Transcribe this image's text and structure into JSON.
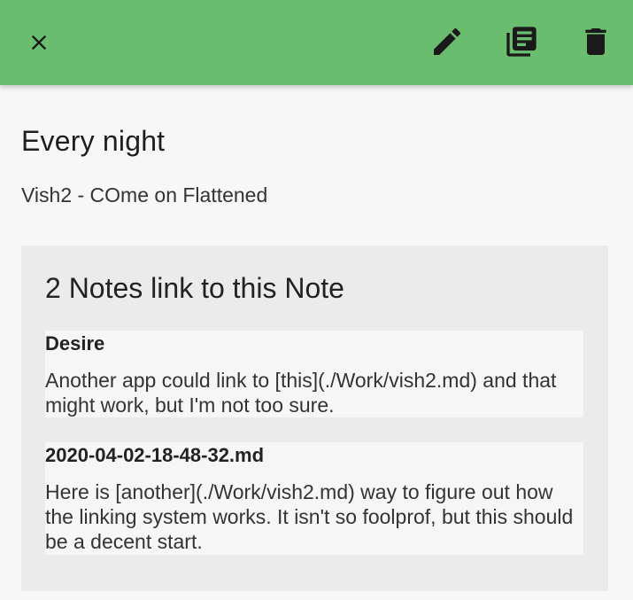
{
  "appbar": {
    "color": "#6abd6e",
    "icons": {
      "close": "close-icon",
      "edit": "pencil-icon",
      "library": "library-books-icon",
      "delete": "trash-icon"
    }
  },
  "note": {
    "title": "Every night",
    "body": "Vish2 - COme on Flattened"
  },
  "backlinks": {
    "heading": "2 Notes link to this Note",
    "items": [
      {
        "title": "Desire",
        "text": "Another app could link to [this](./Work/vish2.md) and that might work, but I'm not too sure."
      },
      {
        "title": "2020-04-02-18-48-32.md",
        "text": "Here is [another](./Work/vish2.md) way to figure out how the linking system works. It isn't so foolprof, but this should be a decent start."
      }
    ]
  }
}
